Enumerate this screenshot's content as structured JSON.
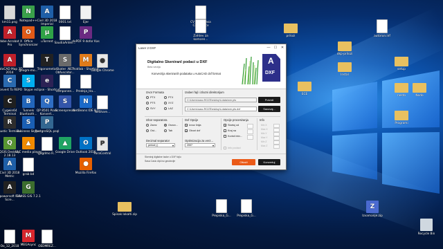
{
  "desktop": {
    "left_icons": [
      {
        "label": "km11.png",
        "color": "#d9d9d9",
        "glyph": ""
      },
      {
        "label": "Notepad++",
        "color": "#3aa04a",
        "glyph": "N"
      },
      {
        "label": "Civil 3D 2018 Imperial",
        "color": "#1f5fa8",
        "glyph": "A"
      },
      {
        "label": "0001.txt",
        "color": "#ffffff",
        "glyph": ""
      },
      {
        "label": "Ejer",
        "color": "#f2f2f2",
        "glyph": ""
      },
      {
        "label": "Adobe Acrobat X Pro",
        "color": "#c0202a",
        "glyph": "A"
      },
      {
        "label": "Office Synchronizer",
        "color": "#e25a17",
        "glyph": "O"
      },
      {
        "label": "uTorrent",
        "color": "#2fa347",
        "glyph": "μ"
      },
      {
        "label": "SaudiaAnteil...",
        "color": "#ffffff",
        "glyph": ""
      },
      {
        "label": "doPDF 9 dofor Kas",
        "color": "#6b2a82",
        "glyph": "P"
      },
      {
        "label": "AutoCAD Map 3D 2014",
        "color": "#c0202a",
        "glyph": "A"
      },
      {
        "label": "geogm-mo...",
        "color": "#ffffff",
        "glyph": ""
      },
      {
        "label": "Trigonometar",
        "color": "#222222",
        "glyph": "T"
      },
      {
        "label": "Skater .NET Obfuscator...",
        "color": "#6a6a6a",
        "glyph": "S"
      },
      {
        "label": "matlab - Shortcut",
        "color": "#e07b1a",
        "glyph": "M"
      },
      {
        "label": "Google Chrome",
        "color": "#e8e8e8",
        "glyph": "●"
      },
      {
        "label": "Convert To REPO",
        "color": "#2a6ab0",
        "glyph": "C"
      },
      {
        "label": "Skype",
        "color": "#00aff0",
        "glyph": "S"
      },
      {
        "label": "eclipse - Shortcut",
        "color": "#2c2255",
        "glyph": "e"
      },
      {
        "label": "componen...",
        "color": "#ffffff",
        "glyph": ""
      },
      {
        "label": "Prednja_Ha...",
        "color": "#ffffff",
        "glyph": ""
      },
      {
        "label": "Cygwin64 Terminal",
        "color": "#1f1f1f",
        "glyph": "C"
      },
      {
        "label": "Tunnels Bluetooth...",
        "color": "#2266bb",
        "glyph": "B"
      },
      {
        "label": "QP 8501 Piam Konvert...",
        "color": "#2f6ec4",
        "glyph": "Q"
      },
      {
        "label": "Screenpresso",
        "color": "#3355aa",
        "glyph": "S"
      },
      {
        "label": "NetBeans IDE 8.1",
        "color": "#1b6ac9",
        "glyph": "N"
      },
      {
        "label": "NeShare...",
        "color": "#ffffff",
        "glyph": ""
      },
      {
        "label": "Rustic Terminal",
        "color": "#2d2d2d",
        "glyph": "R"
      },
      {
        "label": "Business Skype",
        "color": "#1a5fb4",
        "glyph": "S"
      },
      {
        "label": "PostgreSQL psql",
        "color": "#336791",
        "glyph": "P"
      },
      {
        "label": "QGIS Desktop 2.18.13",
        "color": "#589632",
        "glyph": "Q"
      },
      {
        "label": "VLC media player",
        "color": "#f08a00",
        "glyph": "▲"
      },
      {
        "label": "gdgdmo R...",
        "color": "#ffffff",
        "glyph": ""
      },
      {
        "label": "Google Drive",
        "color": "#1fa463",
        "glyph": "▲"
      },
      {
        "label": "Outlook 2016",
        "color": "#0072c6",
        "glyph": "O"
      },
      {
        "label": "ParaControl",
        "color": "#e6e6e6",
        "glyph": "P"
      },
      {
        "label": "Civil 3D 2018 Metric",
        "color": "#1f5fa8",
        "glyph": "A"
      },
      {
        "label": "grab bd",
        "color": "#ffffff",
        "glyph": ""
      },
      {
        "label": "Mozilla Firefox",
        "color": "#e66000",
        "glyph": "●"
      },
      {
        "label": "Apowersoft Free Scre...",
        "color": "#222222",
        "glyph": "A"
      },
      {
        "label": "GRASS GIS 7.2.1",
        "color": "#3c6e2e",
        "glyph": "G"
      },
      {
        "label": "Oo_12_2018",
        "color": "#ffffff",
        "glyph": ""
      },
      {
        "label": "MEGAsync",
        "color": "#d9272e",
        "glyph": "M"
      },
      {
        "label": "OEDMREZ...",
        "color": "#ffffff",
        "glyph": ""
      }
    ],
    "right_icons": [
      {
        "label": "CV Ilirmi Sasa Casic.docx",
        "color": "#ffffff",
        "glyph": ""
      },
      {
        "label": "Zahtev za komcen...",
        "color": "#ffffff",
        "glyph": ""
      },
      {
        "label": "autorun.inf",
        "color": "#ffffff",
        "glyph": ""
      },
      {
        "label": "prilozi",
        "color": "#e8c060",
        "glyph": ""
      },
      {
        "label": "dkp-prilozi",
        "color": "#e8c060",
        "glyph": ""
      },
      {
        "label": "Instal",
        "color": "#e8c060",
        "glyph": ""
      },
      {
        "label": "setup",
        "color": "#e8c060",
        "glyph": ""
      },
      {
        "label": "ECE",
        "color": "#e8c060",
        "glyph": ""
      },
      {
        "label": "nesto",
        "color": "#e8c060",
        "glyph": ""
      },
      {
        "label": "Nodo",
        "color": "#e8c060",
        "glyph": ""
      },
      {
        "label": "Programi",
        "color": "#e8c060",
        "glyph": ""
      },
      {
        "label": "Spisak lokalti.zip",
        "color": "#e8c060",
        "glyph": ""
      },
      {
        "label": "Prepiska_G...",
        "color": "#ffffff",
        "glyph": ""
      },
      {
        "label": "Prepiska_G...",
        "color": "#ffffff",
        "glyph": ""
      },
      {
        "label": "Izvamanje.zip",
        "color": "#4a6ad0",
        "glyph": "Z"
      },
      {
        "label": "Recycle Bin",
        "color": "#cfd8e0",
        "glyph": ""
      }
    ]
  },
  "dialog": {
    "title": "Laser 2 DXF",
    "controls": [
      "—",
      "☐",
      "✕"
    ],
    "header_title": "Digitalno Skeniranî podaci u DXF",
    "header_sub": "Beta verzija",
    "header_desc": "Konverzija skeniranih podataka u AutoCAD dxf format",
    "logo_letter": "A",
    "logo_text": "DXF",
    "format_section": "Izvor Formata",
    "formats": [
      {
        "label": "PTX",
        "checked": false
      },
      {
        "label": "PTX",
        "checked": false
      },
      {
        "label": "PTS",
        "checked": false
      },
      {
        "label": "XYZ",
        "checked": false
      },
      {
        "label": "SVY",
        "checked": false
      },
      {
        "label": "LAZ",
        "checked": false
      }
    ],
    "files_section": "Izaberi fajl i izlazni direktorijum",
    "input_path": "C:\\Users\\sasc.RGZE\\esktop\\Ldata\\wm.pts",
    "output_path": "C:\\Users\\sasc.RGZE\\esktop\\Ldata\\wm.pts.dxf",
    "browse_label": "Potvrdi",
    "save_label": "Sacuvaj...",
    "separator_section": "Izbor separatora",
    "separators": [
      {
        "label": "Zarez",
        "checked": false
      },
      {
        "label": "Osnov...",
        "checked": true
      },
      {
        "label": "Ost...",
        "checked": false
      },
      {
        "label": "Tab",
        "checked": false
      }
    ],
    "decimal_section": "Decimal separator",
    "decimal_value": "period (.)",
    "dxf_section": "Dxf Opcije",
    "dxf_opts": [
      {
        "label": "Izvoz linija",
        "checked": true
      },
      {
        "label": "Otvori dxf",
        "checked": true
      }
    ],
    "optim_section": "Optimizacija za verz...",
    "optim_value": "2007",
    "proc_section": "Opcije procesiranja",
    "proc_opts": [
      {
        "label": "Startuj od",
        "checked": true
      },
      {
        "label": "Kraj na",
        "checked": false
      },
      {
        "label": "Koristi intn...",
        "checked": false
      }
    ],
    "info_section": "Info",
    "info_items": [
      "Min X",
      "Max X",
      "Min Y",
      "Max Y",
      "Min Z",
      "Max Z"
    ],
    "info_check": "Info podaci",
    "status1": "Skeniraj digitalne tacke u DXF fajlu",
    "status2": "Sasa Casic dipl.inz.geodezije",
    "cancel_label": "Otkaži",
    "convert_label": "Konvertuj"
  }
}
